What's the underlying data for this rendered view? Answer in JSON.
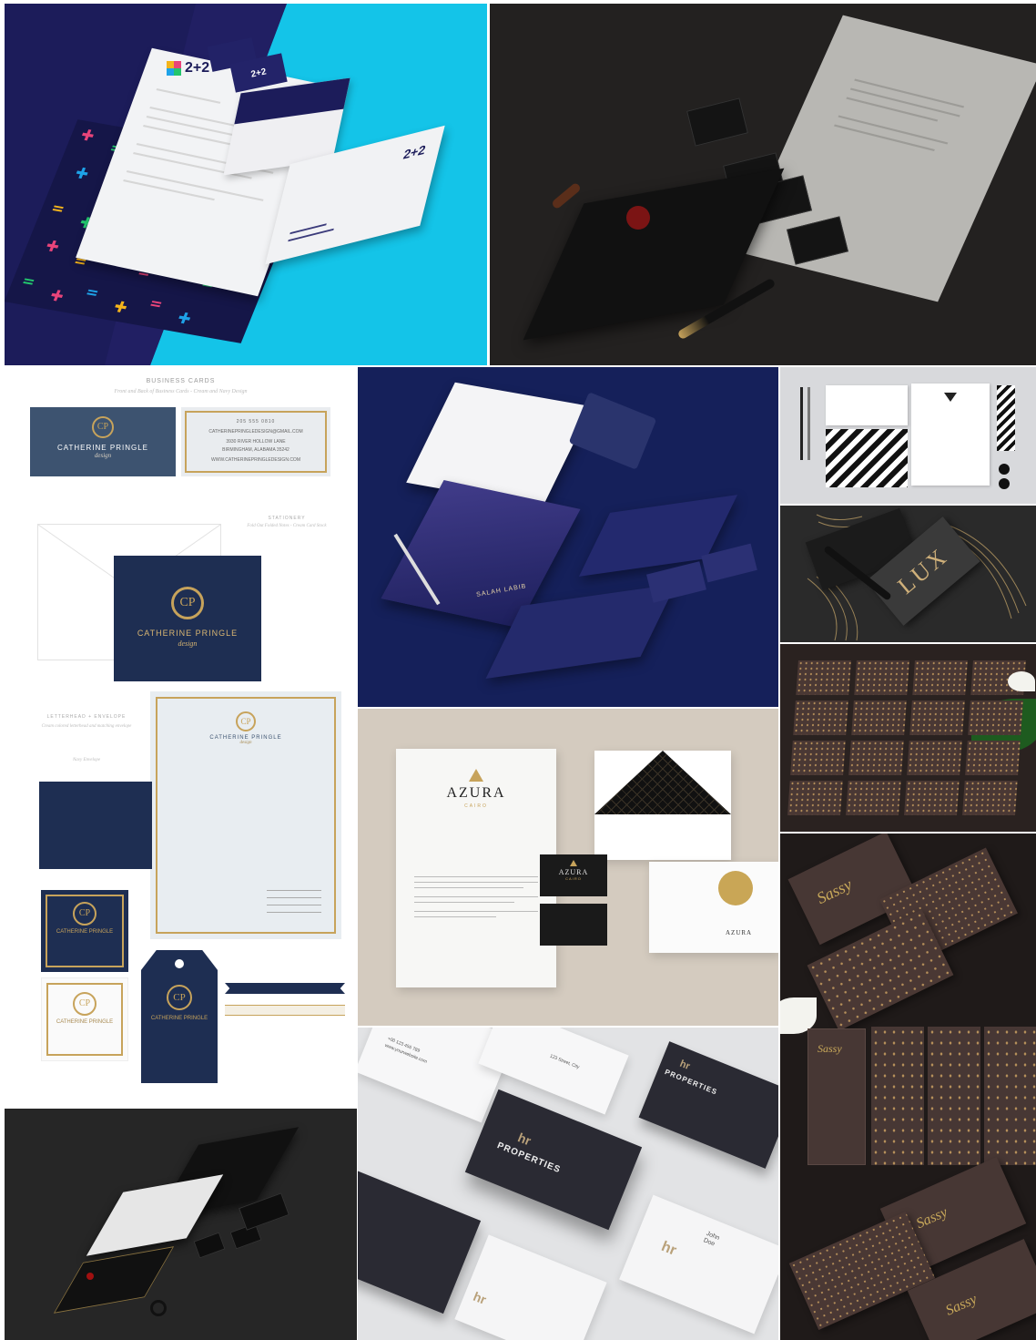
{
  "tiles": {
    "t1": {
      "brand": "2+2"
    },
    "t3": {
      "header": "BUSINESS CARDS",
      "header_sub": "Front and Back of Business Cards - Cream and Navy Design",
      "brand": "CATHERINE PRINGLE",
      "script": "design",
      "monogram": "CP",
      "card_back": {
        "phone": "205 555 0810",
        "email": "CATHERINEPRINGLEDESIGN@GMAIL.COM",
        "address1": "3930 RIVER HOLLOW LANE",
        "address2": "BIRMINGHAM, ALABAMA 35242",
        "web": "WWW.CATHERINEPRINGLEDESIGN.COM"
      },
      "stationery_label": "STATIONERY",
      "stationery_sub": "Fold Out Folded Notes - Cream Card Stock",
      "letterhead_label": "LETTERHEAD + ENVELOPE",
      "letterhead_sub": "Cream colored letterhead and matching envelope",
      "letterhead_sub2": "Navy Envelope"
    },
    "t4": {
      "brand": "SALAH LABIB"
    },
    "t6": {
      "brand": "LUX"
    },
    "t8": {
      "brand": "AZURA",
      "sub": "CAIRO"
    },
    "t9": {
      "brand": "PROPERTIES",
      "logo": "hr",
      "name_first": "John",
      "name_last": "Doe",
      "contact1": "+00 123 456 789",
      "contact2": "www.yourwebsite.com",
      "contact3": "123 Street, City"
    },
    "t10": {
      "script": "Sassy"
    }
  },
  "colors": {
    "navy": "#1e2e52",
    "dusty_navy": "#3d5370",
    "gold": "#c7a35b",
    "cyan": "#16c3e6",
    "dark": "#1a1a1a",
    "brown": "#3d2f2c"
  }
}
